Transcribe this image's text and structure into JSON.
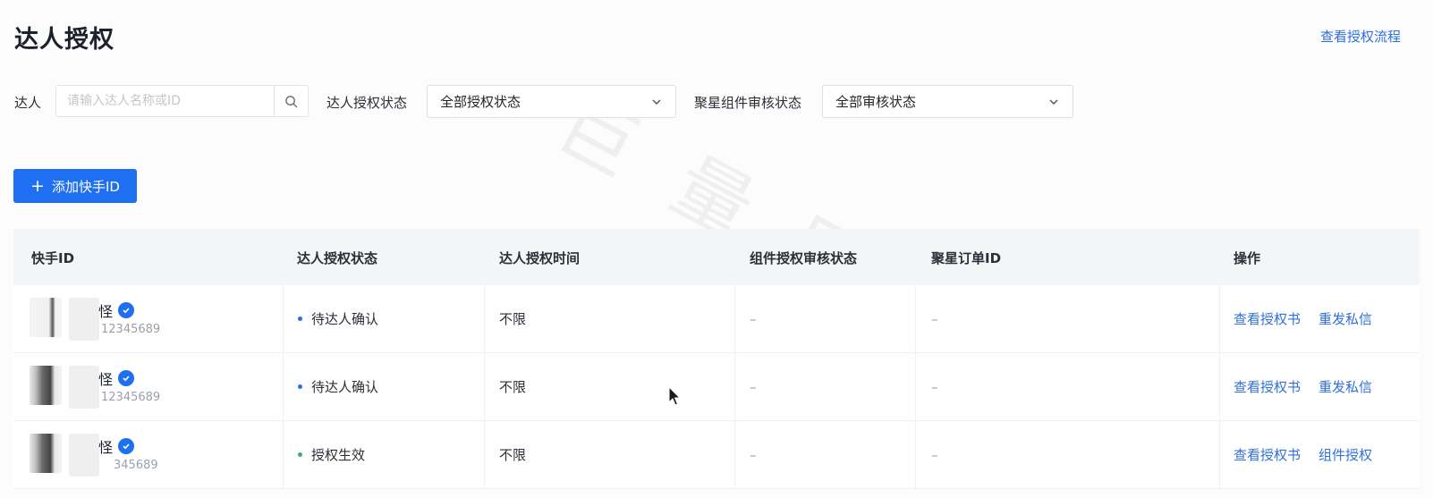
{
  "page": {
    "title": "达人授权",
    "view_flow_link": "查看授权流程",
    "watermark": "巨量网络"
  },
  "filters": {
    "creator_label": "达人",
    "creator_placeholder": "请输入达人名称或ID",
    "auth_status_label": "达人授权状态",
    "auth_status_value": "全部授权状态",
    "review_status_label": "聚星组件审核状态",
    "review_status_value": "全部审核状态"
  },
  "actions": {
    "add_button": "添加快手ID",
    "add_icon": "plus-icon"
  },
  "table": {
    "headers": [
      "快手ID",
      "达人授权状态",
      "达人授权时间",
      "组件授权审核状态",
      "聚星订单ID",
      "操作"
    ],
    "rows": [
      {
        "name": "怪",
        "id": "12345689",
        "auth_status": "待达人确认",
        "status_color": "#1f6ff2",
        "auth_time": "不限",
        "review_status": "–",
        "order_id": "–",
        "op1": "查看授权书",
        "op2": "重发私信"
      },
      {
        "name": "怪",
        "id": "12345689",
        "auth_status": "待达人确认",
        "status_color": "#1f6ff2",
        "auth_time": "不限",
        "review_status": "–",
        "order_id": "–",
        "op1": "查看授权书",
        "op2": "重发私信"
      },
      {
        "name": "怪",
        "id": "345689",
        "auth_status": "授权生效",
        "status_color": "#2fb86b",
        "auth_time": "不限",
        "review_status": "–",
        "order_id": "–",
        "op1": "查看授权书",
        "op2": "组件授权"
      }
    ]
  }
}
